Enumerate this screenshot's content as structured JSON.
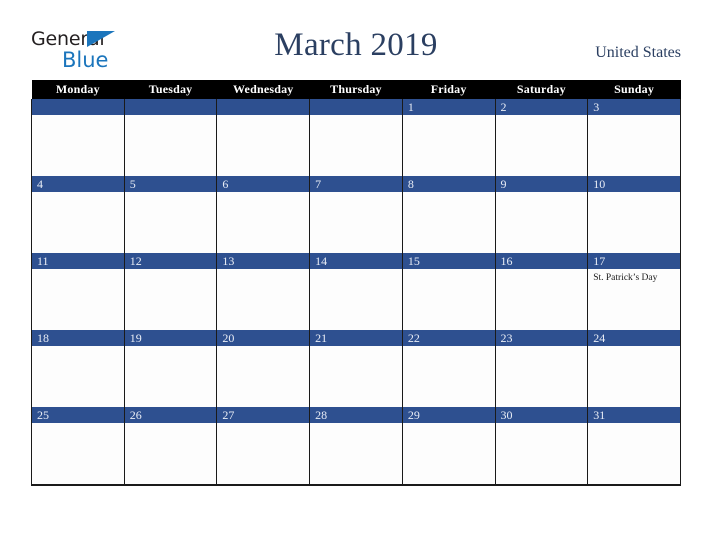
{
  "brand": {
    "name_part1": "General",
    "name_part2": "Blue",
    "triangle_color": "#1b75bc",
    "text_color": "#231f20"
  },
  "header": {
    "title": "March 2019",
    "country": "United States",
    "title_color": "#2b3f61"
  },
  "calendar": {
    "month": "March",
    "year": "2019",
    "weekday_headers": [
      "Monday",
      "Tuesday",
      "Wednesday",
      "Thursday",
      "Friday",
      "Saturday",
      "Sunday"
    ],
    "header_bg": "#000000",
    "header_text": "#ffffff",
    "date_band_color": "#2e5090",
    "date_text_color": "#e8ecf5",
    "weeks": [
      [
        {
          "day": "",
          "events": []
        },
        {
          "day": "",
          "events": []
        },
        {
          "day": "",
          "events": []
        },
        {
          "day": "",
          "events": []
        },
        {
          "day": "1",
          "events": []
        },
        {
          "day": "2",
          "events": []
        },
        {
          "day": "3",
          "events": []
        }
      ],
      [
        {
          "day": "4",
          "events": []
        },
        {
          "day": "5",
          "events": []
        },
        {
          "day": "6",
          "events": []
        },
        {
          "day": "7",
          "events": []
        },
        {
          "day": "8",
          "events": []
        },
        {
          "day": "9",
          "events": []
        },
        {
          "day": "10",
          "events": []
        }
      ],
      [
        {
          "day": "11",
          "events": []
        },
        {
          "day": "12",
          "events": []
        },
        {
          "day": "13",
          "events": []
        },
        {
          "day": "14",
          "events": []
        },
        {
          "day": "15",
          "events": []
        },
        {
          "day": "16",
          "events": []
        },
        {
          "day": "17",
          "events": [
            "St. Patrick’s Day"
          ]
        }
      ],
      [
        {
          "day": "18",
          "events": []
        },
        {
          "day": "19",
          "events": []
        },
        {
          "day": "20",
          "events": []
        },
        {
          "day": "21",
          "events": []
        },
        {
          "day": "22",
          "events": []
        },
        {
          "day": "23",
          "events": []
        },
        {
          "day": "24",
          "events": []
        }
      ],
      [
        {
          "day": "25",
          "events": []
        },
        {
          "day": "26",
          "events": []
        },
        {
          "day": "27",
          "events": []
        },
        {
          "day": "28",
          "events": []
        },
        {
          "day": "29",
          "events": []
        },
        {
          "day": "30",
          "events": []
        },
        {
          "day": "31",
          "events": []
        }
      ]
    ]
  }
}
